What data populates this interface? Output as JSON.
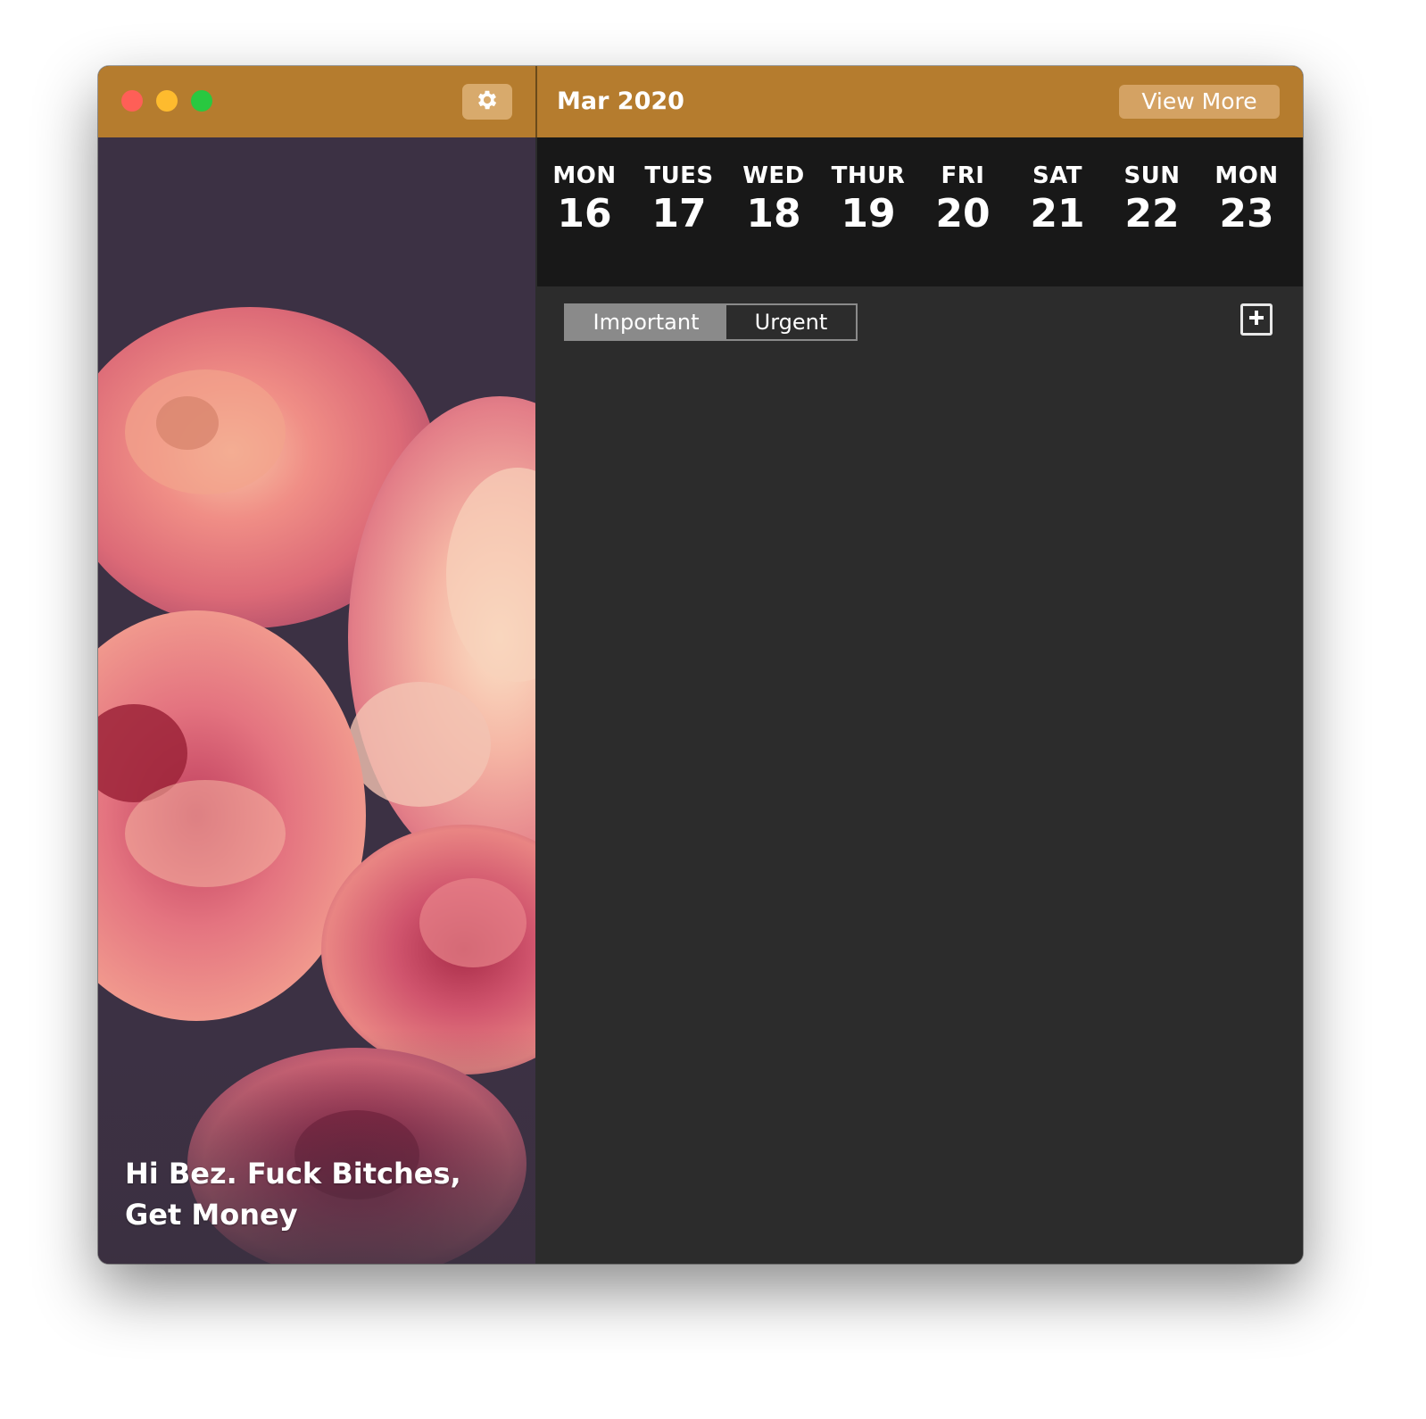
{
  "window": {
    "title_controls": [
      "close",
      "minimize",
      "maximize"
    ]
  },
  "sidebar": {
    "settings_icon": "gear-icon",
    "greeting_line1": "Hi Bez. Fuck Bitches,",
    "greeting_line2": "Get Money",
    "background_image": "pink-roses-photo"
  },
  "header": {
    "month": "Mar 2020",
    "view_more_label": "View More"
  },
  "week": [
    {
      "day": "MON",
      "date": "16"
    },
    {
      "day": "TUES",
      "date": "17"
    },
    {
      "day": "WED",
      "date": "18"
    },
    {
      "day": "THUR",
      "date": "19"
    },
    {
      "day": "FRI",
      "date": "20"
    },
    {
      "day": "SAT",
      "date": "21"
    },
    {
      "day": "SUN",
      "date": "22"
    },
    {
      "day": "MON",
      "date": "23"
    }
  ],
  "filters": {
    "options": [
      "Important",
      "Urgent"
    ],
    "selected": "Important"
  },
  "add_icon": "plus-square-icon",
  "colors": {
    "accent": "#b57c2e",
    "week_strip_bg": "#181818",
    "content_bg": "#2c2c2c",
    "segment_active": "#8a8a8a"
  }
}
